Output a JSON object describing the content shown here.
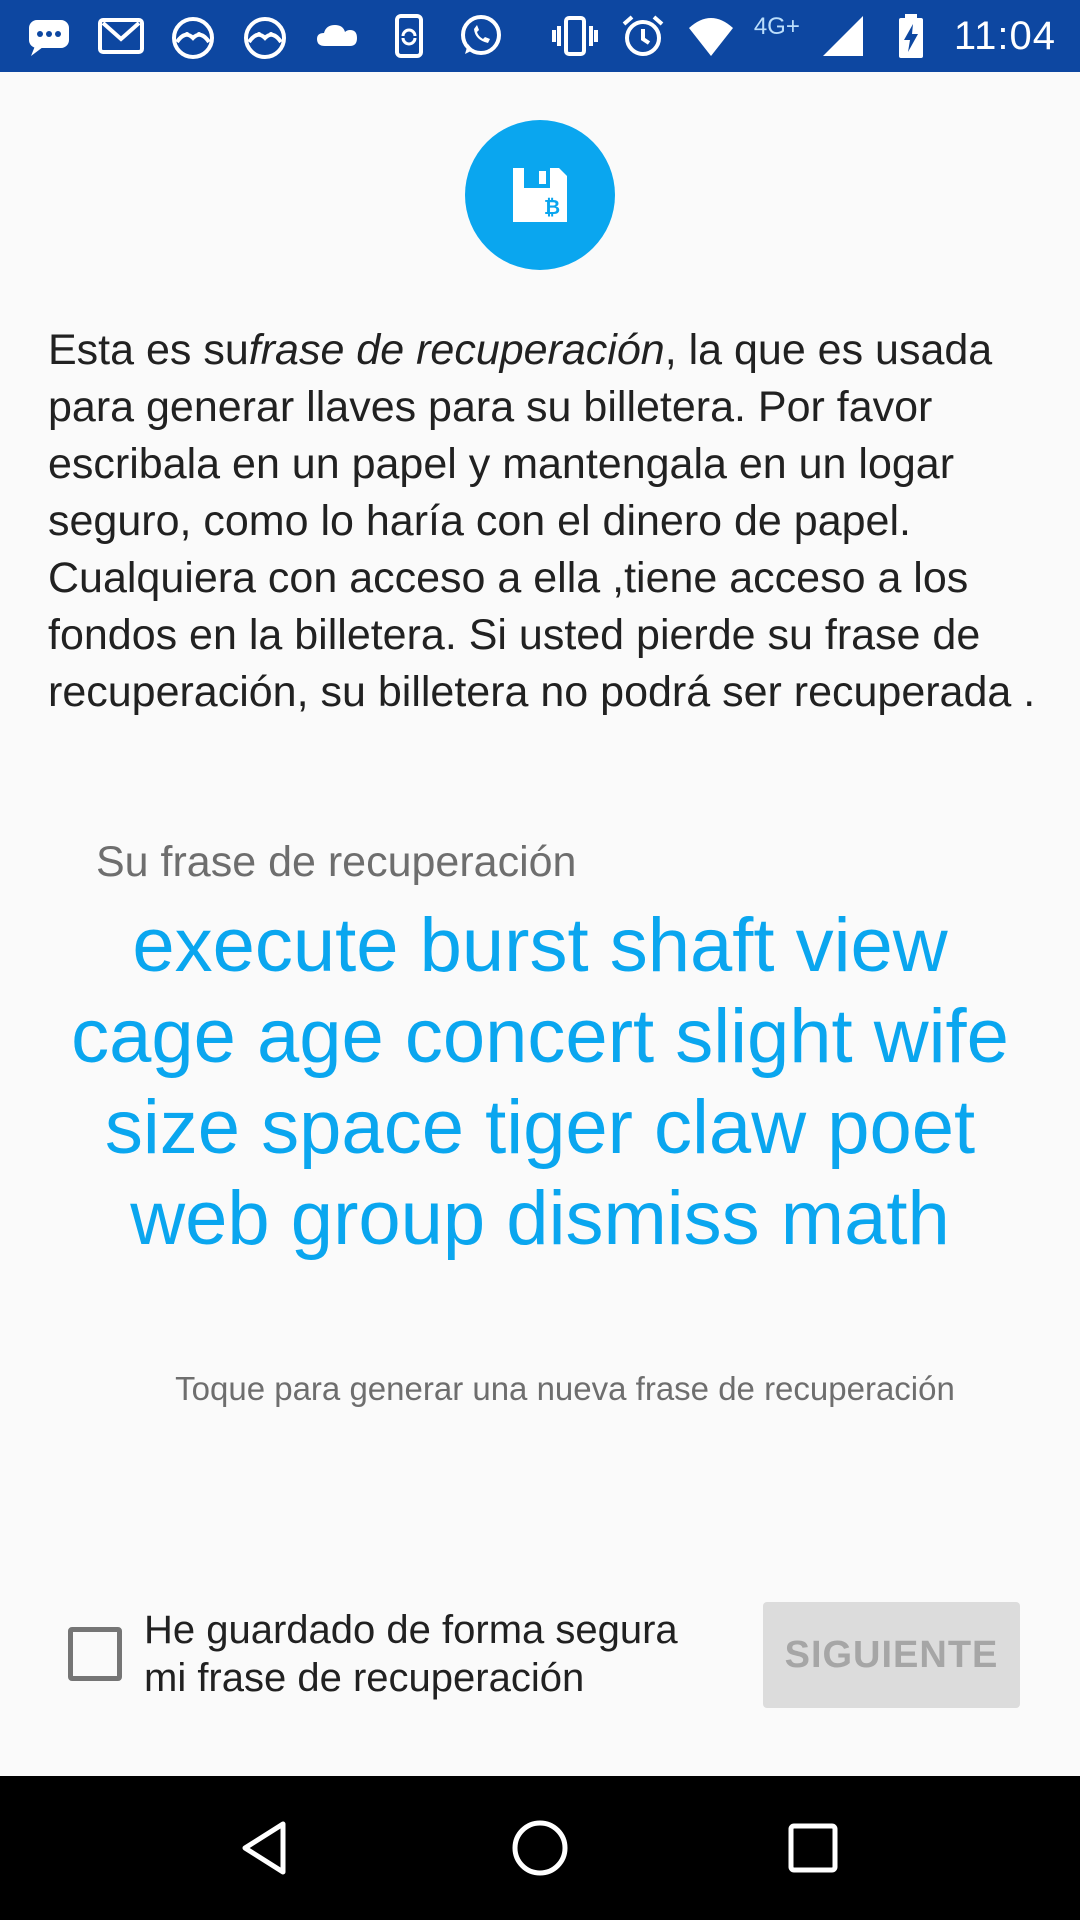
{
  "status_bar": {
    "network_type": "4G+",
    "time": "11:04",
    "notification_icons": [
      "messages-icon",
      "gmail-icon",
      "basecamp-icon",
      "basecamp-icon",
      "cloud-icon",
      "phone-sync-icon",
      "whatsapp-icon"
    ],
    "system_icons": [
      "vibrate-icon",
      "alarm-icon",
      "wifi-icon",
      "signal-icon",
      "battery-charging-icon"
    ]
  },
  "header": {
    "logo_icon": "floppy-bitcoin-icon",
    "accent_color": "#0aa6ef"
  },
  "intro": {
    "part1": "Esta es su",
    "emphasis": "frase de recuperación",
    "part2": ", la que es usada para generar llaves para su billetera. Por favor escribala en un papel y mantengala en un logar seguro, como lo haría con el dinero de papel. Cualquiera con acceso a ella ,tiene acceso a los fondos en la billetera. Si usted pierde su frase de recuperación, su billetera no podrá ser recuperada ."
  },
  "recovery": {
    "label": "Su frase de recuperación",
    "phrase": "execute burst shaft view cage age concert slight wife size space tiger claw poet web group dismiss math",
    "hint": "Toque para generar una nueva frase de recuperación"
  },
  "footer": {
    "checkbox_label": "He guardado de forma segura mi frase de recuperación",
    "checkbox_checked": false,
    "next_label": "SIGUIENTE",
    "next_enabled": false
  },
  "nav": {
    "back_icon": "back-icon",
    "home_icon": "home-icon",
    "recents_icon": "recents-icon"
  }
}
